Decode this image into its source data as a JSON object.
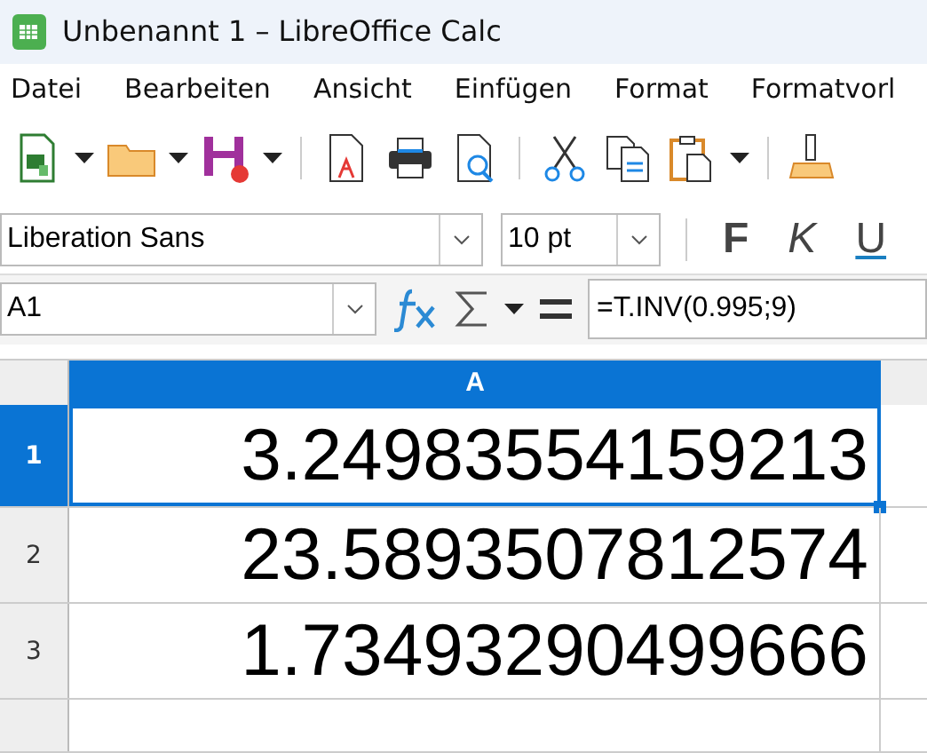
{
  "window": {
    "title": "Unbenannt 1 – LibreOffice Calc"
  },
  "menu": [
    "Datei",
    "Bearbeiten",
    "Ansicht",
    "Einfügen",
    "Format",
    "Formatvorl"
  ],
  "format_bar": {
    "font_name": "Liberation Sans",
    "font_size": "10 pt",
    "bold": "F",
    "italic": "K",
    "underline": "U"
  },
  "formula_bar": {
    "name_box": "A1",
    "formula": "=T.INV(0.995;9)"
  },
  "columns": [
    {
      "label": "A",
      "selected": true
    }
  ],
  "rows": [
    {
      "number": "1",
      "value": "3.24983554159213",
      "selected": true
    },
    {
      "number": "2",
      "value": "23.5893507812574",
      "selected": false
    },
    {
      "number": "3",
      "value": "1.73493290499666",
      "selected": false
    }
  ]
}
